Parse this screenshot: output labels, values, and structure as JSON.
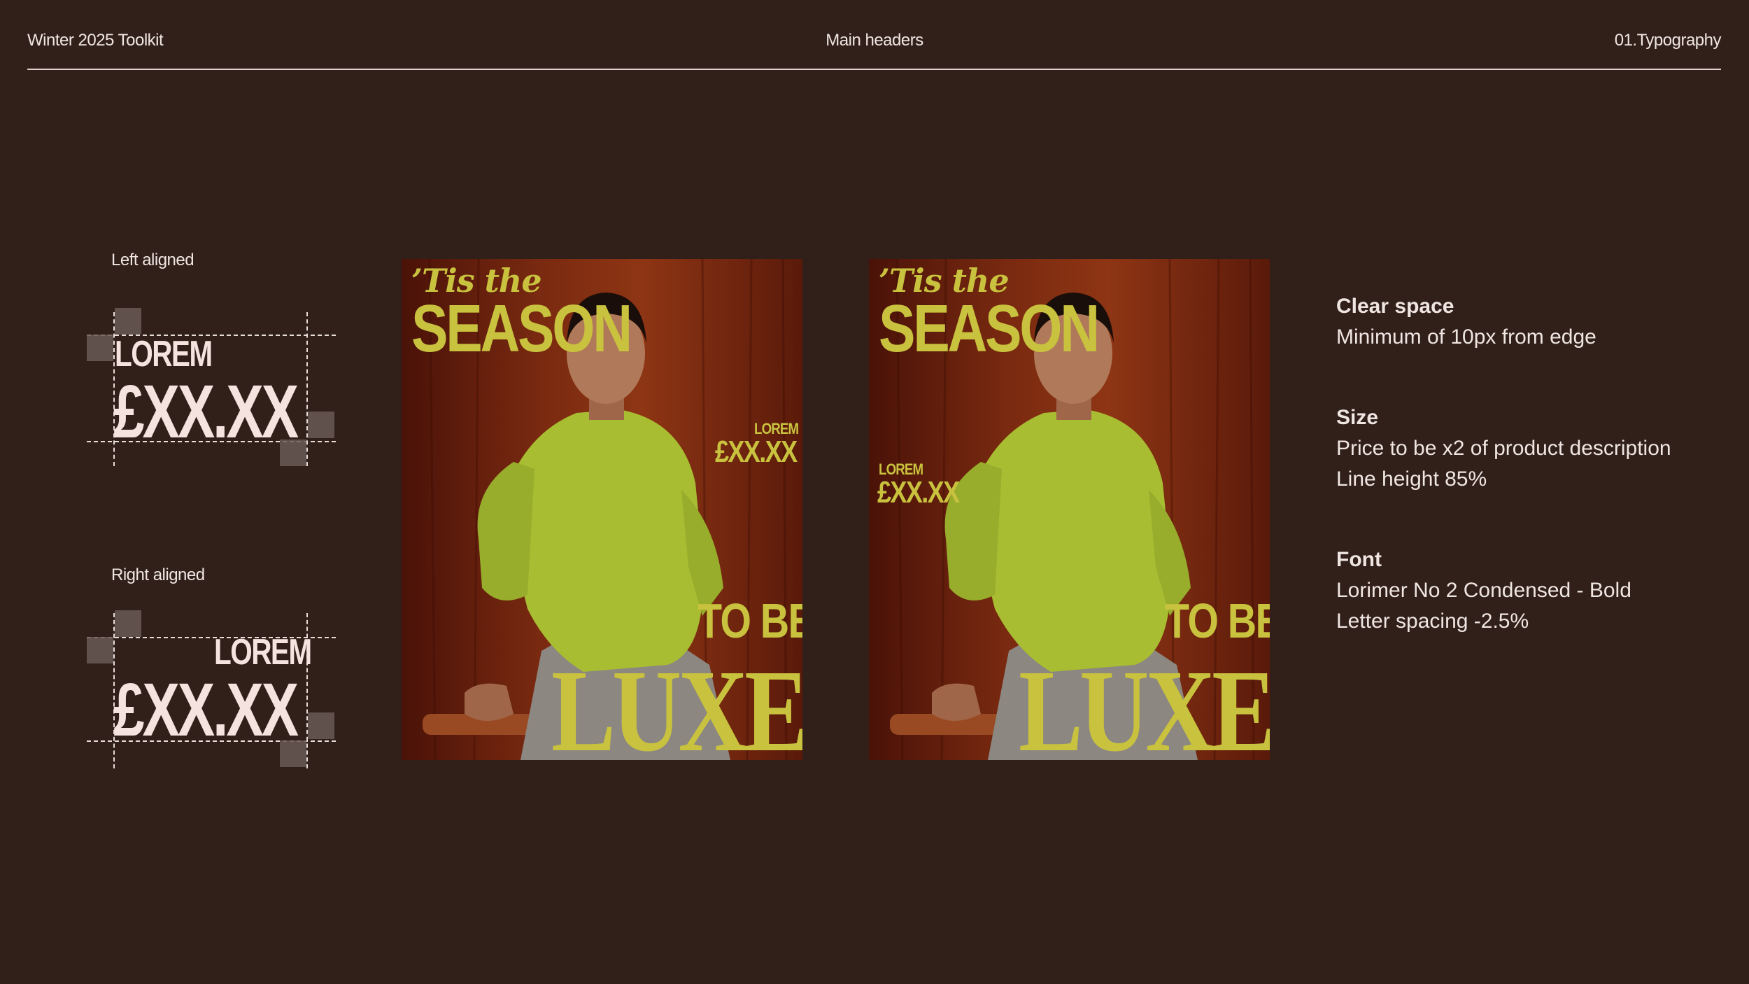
{
  "header": {
    "left": "Winter 2025 Toolkit",
    "center": "Main headers",
    "right": "01.Typography"
  },
  "specimens": {
    "left": {
      "label": "Left aligned",
      "product": "LOREM",
      "price": "£XX.XX"
    },
    "right": {
      "label": "Right aligned",
      "product": "LOREM",
      "price": "£XX.XX"
    }
  },
  "posters": [
    {
      "tagline": "’Tis the",
      "headline": "SEASON",
      "product": "LOREM",
      "price": "£XX.XX",
      "line1": "TO BE",
      "line2": "LUXE"
    },
    {
      "tagline": "’Tis the",
      "headline": "SEASON",
      "product": "LOREM",
      "price": "£XX.XX",
      "line1": "TO BE",
      "line2": "LUXE"
    }
  ],
  "info": {
    "clear_space": {
      "title": "Clear space",
      "lines": [
        "Minimum of 10px from edge"
      ]
    },
    "size": {
      "title": "Size",
      "lines": [
        "Price to be x2 of product description",
        "Line height 85%"
      ]
    },
    "font": {
      "title": "Font",
      "lines": [
        "Lorimer No 2 Condensed - Bold",
        "Letter spacing -2.5%"
      ]
    }
  },
  "colors": {
    "background": "#311f1a",
    "accent_text": "#c9c23e",
    "specimen_text": "#f4e3df"
  }
}
